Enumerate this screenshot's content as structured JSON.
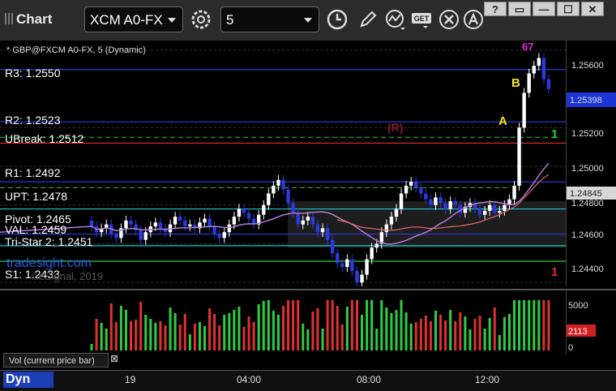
{
  "toolbar": {
    "title": "Chart",
    "symbol": "XCM A0-FX",
    "interval": "5",
    "icons": [
      "settings-icon",
      "clock-icon",
      "pencil-icon",
      "indicator-icon",
      "get-icon",
      "close-circle-icon"
    ]
  },
  "window_buttons": [
    "?",
    "▭",
    "—",
    "☐",
    "✕"
  ],
  "subtitle": "* GBP@FXCM A0-FX, 5 (Dynamic)",
  "levels": [
    {
      "label": "R3: 1.2550",
      "price": 1.255,
      "color": "#2a3adc"
    },
    {
      "label": "R2: 1.2523",
      "price": 1.2523,
      "color": "#2a3adc"
    },
    {
      "label": "UBreak: 1.2512",
      "price": 1.2512,
      "color": "#e03030"
    },
    {
      "label": "R1: 1.2492",
      "price": 1.2492,
      "color": "#2a3adc"
    },
    {
      "label": "UPT: 1.2478",
      "price": 1.2478,
      "color": "#20c8c8"
    },
    {
      "label": "Pivot: 1.2465",
      "price": 1.2465,
      "color": "#2a3adc"
    },
    {
      "label": "VAL: 1.2459",
      "price": 1.2459,
      "color": "#20c8c8"
    },
    {
      "label": "Tri-Star 2: 1.2451",
      "price": 1.2451,
      "color": "#2ecc40"
    },
    {
      "label": "S1: 1.2433",
      "price": 1.2433,
      "color": "#e03030"
    }
  ],
  "watermark": "tradesight.com",
  "copyright": "©eSignal, 2019",
  "price_axis": {
    "ticks": [
      "1.25600",
      "1.25200",
      "1.25000",
      "1.24800",
      "1.24600",
      "1.24400"
    ],
    "last_price": "1.25398",
    "marker_price": "1.24845"
  },
  "markers": {
    "A": "A",
    "B": "B",
    "R": "(R)",
    "one_top": "1",
    "one_bottom": "1",
    "top_counts": "67"
  },
  "volume": {
    "ticks": [
      "5000",
      "0"
    ],
    "last": "2113",
    "label": "Vol (current price bar)",
    "close": "⊠"
  },
  "time_axis": {
    "labels": [
      "19",
      "04:00",
      "08:00",
      "12:00"
    ]
  },
  "footer": {
    "mode": "Dyn"
  },
  "colors": {
    "up": "#ffffff",
    "down": "#2a3adc",
    "ma": "#b07ad8",
    "ma2": "#e06a6a",
    "vol_up": "#2ecc40",
    "vol_down": "#e03030"
  },
  "chart_data": {
    "type": "candlestick",
    "ylim": [
      1.2438,
      1.2565
    ],
    "close": [
      1.2469,
      1.2466,
      1.2468,
      1.247,
      1.2465,
      1.2463,
      1.2468,
      1.2472,
      1.247,
      1.2467,
      1.2462,
      1.2466,
      1.2469,
      1.2471,
      1.2468,
      1.2466,
      1.247,
      1.2474,
      1.2472,
      1.2469,
      1.247,
      1.2468,
      1.2471,
      1.2473,
      1.2469,
      1.2465,
      1.2463,
      1.2466,
      1.247,
      1.2474,
      1.2478,
      1.2476,
      1.2473,
      1.247,
      1.2475,
      1.248,
      1.2486,
      1.249,
      1.2493,
      1.2488,
      1.2481,
      1.2476,
      1.247,
      1.2472,
      1.2474,
      1.247,
      1.2466,
      1.2468,
      1.2462,
      1.2455,
      1.245,
      1.2448,
      1.2452,
      1.2446,
      1.244,
      1.2444,
      1.2452,
      1.2458,
      1.246,
      1.2466,
      1.247,
      1.2474,
      1.2478,
      1.2486,
      1.249,
      1.2492,
      1.2489,
      1.2486,
      1.2483,
      1.248,
      1.2484,
      1.2481,
      1.2478,
      1.2482,
      1.248,
      1.2476,
      1.2479,
      1.2481,
      1.2478,
      1.2475,
      1.2477,
      1.248,
      1.2476,
      1.2477,
      1.248,
      1.2483,
      1.249,
      1.252,
      1.2538,
      1.2548,
      1.2552,
      1.2556,
      1.2545,
      1.254
    ]
  }
}
